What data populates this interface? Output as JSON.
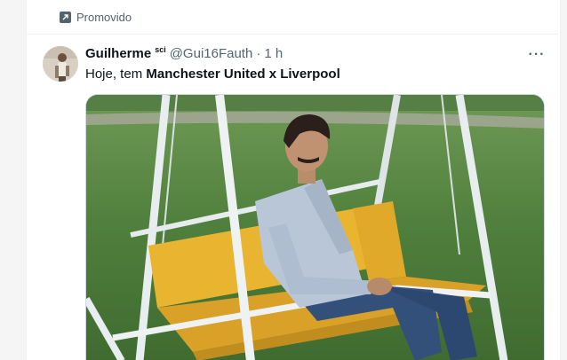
{
  "promo": {
    "label": "Promovido",
    "icon": "promoted-arrow-icon"
  },
  "tweet": {
    "author": {
      "display_name": "Guilherme",
      "name_suffix": "sci",
      "handle": "@Gui16Fauth",
      "separator": "·",
      "time": "1 h",
      "avatar_icon": "avatar-photo"
    },
    "text_prefix": "Hoje, tem ",
    "text_bold": "Manchester United x Liverpool",
    "more_icon": "more-options-icon",
    "more_label": "···",
    "media": {
      "description_icon": "photo-man-sitting-on-swing"
    }
  },
  "colors": {
    "text_primary": "#0f1419",
    "text_secondary": "#536471",
    "divider": "#eff3f4",
    "grass": "#4b7a3a",
    "swing_seat": "#e9b430",
    "swing_frame": "#e6ecee"
  }
}
